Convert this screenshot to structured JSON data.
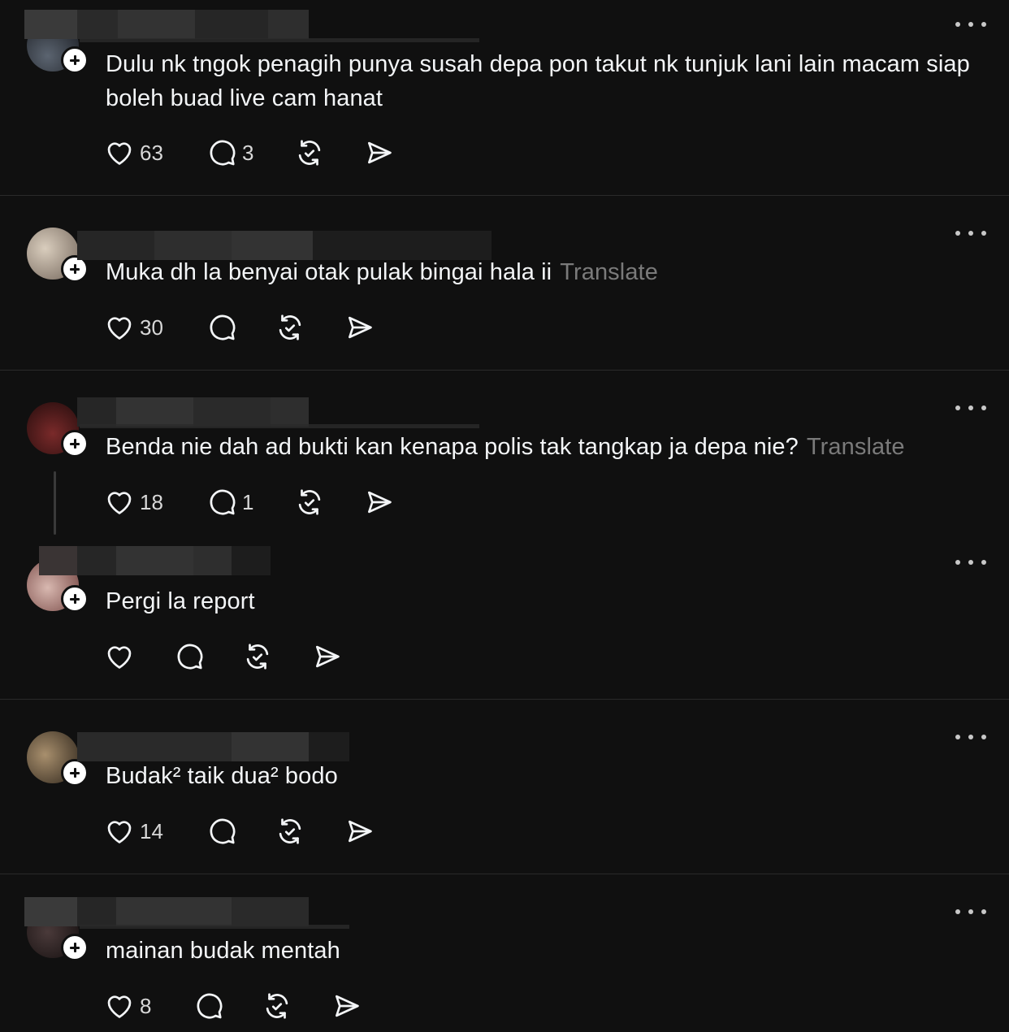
{
  "posts": [
    {
      "text": "Dulu nk tngok penagih punya susah depa pon takut nk tunjuk lani lain macam siap boleh buad live cam hanat",
      "translate": "",
      "likes": "63",
      "replies": "3"
    },
    {
      "text": "Muka dh la benyai otak pulak bingai hala ii",
      "translate": "Translate",
      "likes": "30",
      "replies": ""
    },
    {
      "text": "Benda nie dah ad bukti kan kenapa polis tak tangkap ja depa nie?",
      "translate": "Translate",
      "likes": "18",
      "replies": "1"
    },
    {
      "text": "Pergi la report",
      "translate": "",
      "likes": "",
      "replies": ""
    },
    {
      "text": "Budak² taik dua² bodo",
      "translate": "",
      "likes": "14",
      "replies": ""
    },
    {
      "text": "mainan budak mentah",
      "translate": "",
      "likes": "8",
      "replies": ""
    }
  ],
  "icons": {
    "like": "heart-icon",
    "reply": "comment-icon",
    "repost": "repost-icon",
    "share": "send-icon",
    "more": "more-icon",
    "follow": "plus-icon"
  },
  "colors": {
    "background": "#101010",
    "text": "#f3f5f7",
    "muted": "#7a7a7a",
    "divider": "#2a2a2a"
  }
}
